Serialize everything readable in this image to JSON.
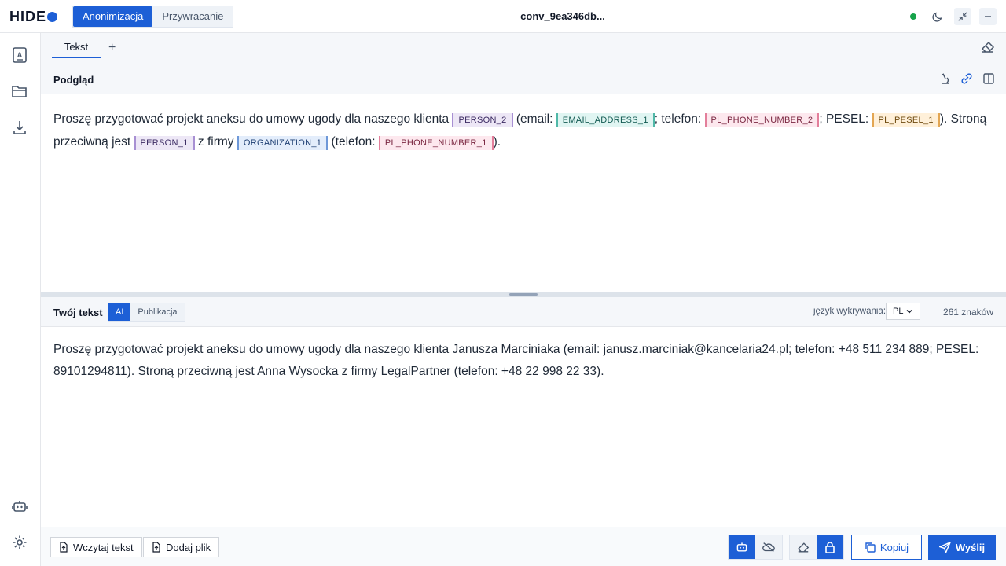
{
  "header": {
    "logo_text": "HIDE",
    "modes": [
      "Anonimizacja",
      "Przywracanie"
    ],
    "active_mode": "Anonimizacja",
    "conversation_title": "conv_9ea346db..."
  },
  "tabs": {
    "items": [
      {
        "label": "Tekst"
      }
    ],
    "add_label": "+"
  },
  "preview": {
    "title": "Podgląd",
    "segments": [
      {
        "type": "text",
        "value": "Proszę przygotować projekt aneksu do umowy ugody dla naszego klienta "
      },
      {
        "type": "token",
        "kind": "person",
        "value": "PERSON_2"
      },
      {
        "type": "text",
        "value": " (email: "
      },
      {
        "type": "token",
        "kind": "email",
        "value": "EMAIL_ADDRESS_1"
      },
      {
        "type": "text",
        "value": "; telefon: "
      },
      {
        "type": "token",
        "kind": "phone",
        "value": "PL_PHONE_NUMBER_2"
      },
      {
        "type": "text",
        "value": "; PESEL: "
      },
      {
        "type": "token",
        "kind": "pesel",
        "value": "PL_PESEL_1"
      },
      {
        "type": "text",
        "value": "). Stroną przeciwną jest "
      },
      {
        "type": "token",
        "kind": "person",
        "value": "PERSON_1"
      },
      {
        "type": "text",
        "value": " z firmy "
      },
      {
        "type": "token",
        "kind": "org",
        "value": "ORGANIZATION_1"
      },
      {
        "type": "text",
        "value": " (telefon: "
      },
      {
        "type": "token",
        "kind": "phone",
        "value": "PL_PHONE_NUMBER_1"
      },
      {
        "type": "text",
        "value": ")."
      }
    ]
  },
  "input": {
    "title": "Twój tekst",
    "modes": [
      "AI",
      "Publikacja"
    ],
    "active_mode": "AI",
    "language_label": "język wykrywania:",
    "language_value": "PL",
    "char_count": "261 znaków",
    "text": "Proszę przygotować projekt aneksu do umowy ugody dla naszego klienta Janusza Marciniaka (email: janusz.marciniak@kancelaria24.pl; telefon: +48 511 234 889; PESEL: 89101294811). Stroną przeciwną jest Anna Wysocka z firmy LegalPartner (telefon: +48 22 998 22 33)."
  },
  "footer": {
    "load_text_label": "Wczytaj tekst",
    "add_file_label": "Dodaj plik",
    "copy_label": "Kopiuj",
    "send_label": "Wyślij"
  },
  "colors": {
    "accent": "#1d5fd6",
    "status_online": "#16a34a"
  }
}
